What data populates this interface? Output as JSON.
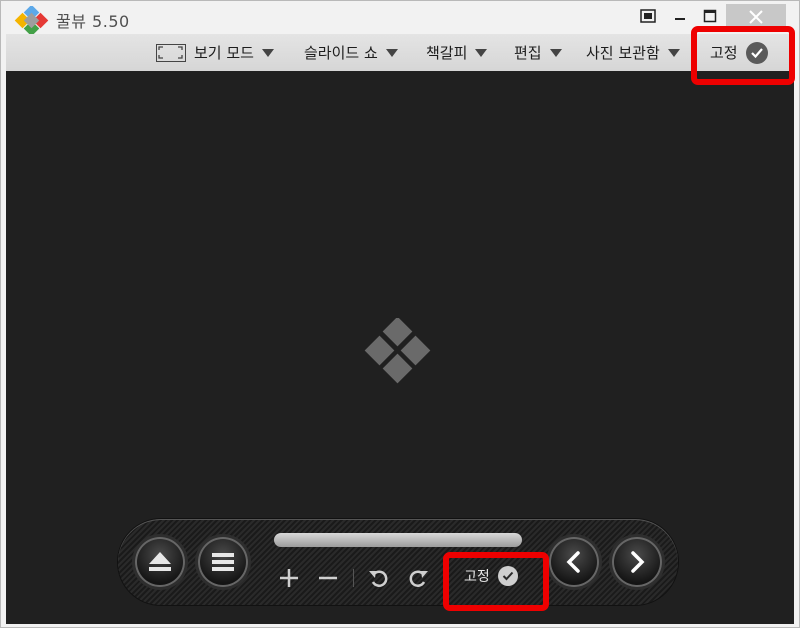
{
  "window": {
    "app_name": "꿀뷰",
    "version": "5.50"
  },
  "menu": {
    "view_mode": "보기 모드",
    "slideshow": "슬라이드 쇼",
    "bookmark": "책갈피",
    "edit": "편집",
    "photo_storage": "사진 보관함",
    "fix": "고정"
  },
  "controls": {
    "fix_label": "고정"
  },
  "colors": {
    "viewer_bg": "#202020",
    "highlight": "#ee0000",
    "logo_gray": "#6a6a6a"
  },
  "icons": {
    "app_logo": "app-logo-icon",
    "view_mode": "fullscreen-frame-icon",
    "check": "check-circle-icon",
    "eject": "eject-icon",
    "list": "menu-list-icon",
    "zoom_in": "plus-icon",
    "zoom_out": "minus-icon",
    "rotate_left": "rotate-left-icon",
    "rotate_right": "rotate-right-icon",
    "prev": "chevron-left-icon",
    "next": "chevron-right-icon"
  }
}
